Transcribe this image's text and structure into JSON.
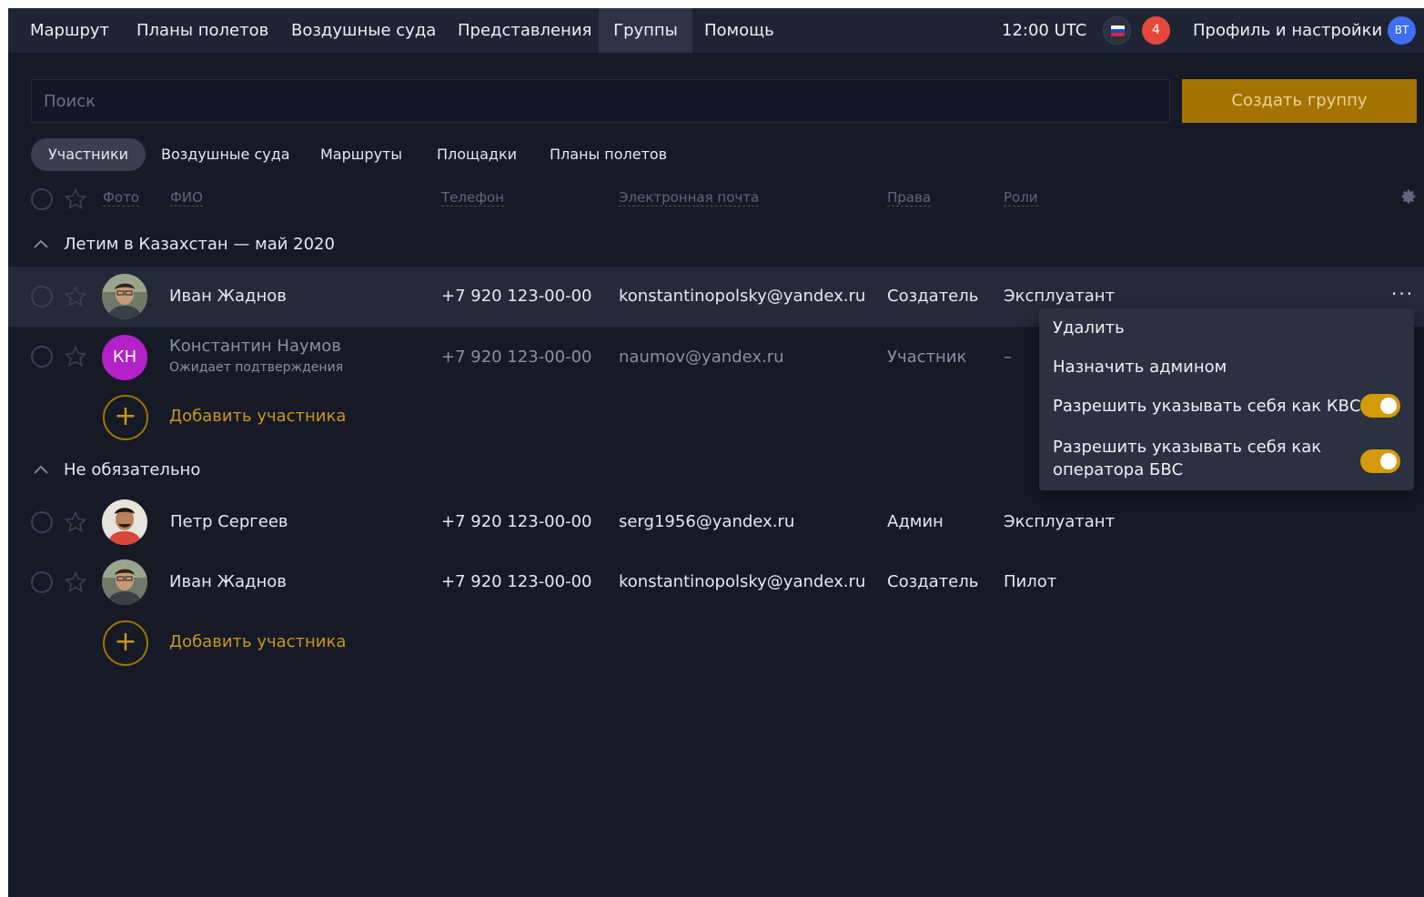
{
  "nav": {
    "items": [
      {
        "label": "Маршрут"
      },
      {
        "label": "Планы полетов"
      },
      {
        "label": "Воздушные суда"
      },
      {
        "label": "Представления"
      },
      {
        "label": "Группы",
        "active": true
      },
      {
        "label": "Помощь"
      }
    ],
    "time": "12:00 UTC",
    "notifications": "4",
    "profile_label": "Профиль и настройки",
    "avatar_initials": "ВТ"
  },
  "search": {
    "placeholder": "Поиск"
  },
  "create_group_label": "Создать группу",
  "tabs": [
    {
      "label": "Участники",
      "active": true
    },
    {
      "label": "Воздушные суда"
    },
    {
      "label": "Маршруты"
    },
    {
      "label": "Площадки"
    },
    {
      "label": "Планы полетов"
    }
  ],
  "columns": {
    "photo": "Фото",
    "name": "ФИО",
    "phone": "Телефон",
    "email": "Электронная почта",
    "rights": "Права",
    "roles": "Роли"
  },
  "groups": [
    {
      "title": "Летим в Казахстан — май 2020",
      "members": [
        {
          "name": "Иван Жаднов",
          "phone": "+7 920 123-00-00",
          "email": "konstantinopolsky@yandex.ru",
          "rights": "Создатель",
          "role": "Эксплуатант"
        },
        {
          "name": "Константин Наумов",
          "status": "Ожидает подтверждения",
          "initials": "КН",
          "phone": "+7 920 123-00-00",
          "email": "naumov@yandex.ru",
          "rights": "Участник",
          "role": "–"
        }
      ],
      "add_label": "Добавить участника"
    },
    {
      "title": "Не обязательно",
      "members": [
        {
          "name": "Петр Сергеев",
          "phone": "+7 920 123-00-00",
          "email": "serg1956@yandex.ru",
          "rights": "Админ",
          "role": "Эксплуатант"
        },
        {
          "name": "Иван Жаднов",
          "phone": "+7 920 123-00-00",
          "email": "konstantinopolsky@yandex.ru",
          "rights": "Создатель",
          "role": "Пилот"
        }
      ],
      "add_label": "Добавить участника"
    }
  ],
  "menu": {
    "delete": "Удалить",
    "make_admin": "Назначить админом",
    "allow_pic": "Разрешить указывать себя как КВС",
    "allow_operator_1": "Разрешить указывать себя как",
    "allow_operator_2": "оператора БВС",
    "allow_pic_on": true,
    "allow_operator_on": true
  },
  "colors": {
    "accent": "#a37400",
    "toggle": "#d49a0a",
    "background": "#151a26",
    "topbar": "#1e2433"
  }
}
